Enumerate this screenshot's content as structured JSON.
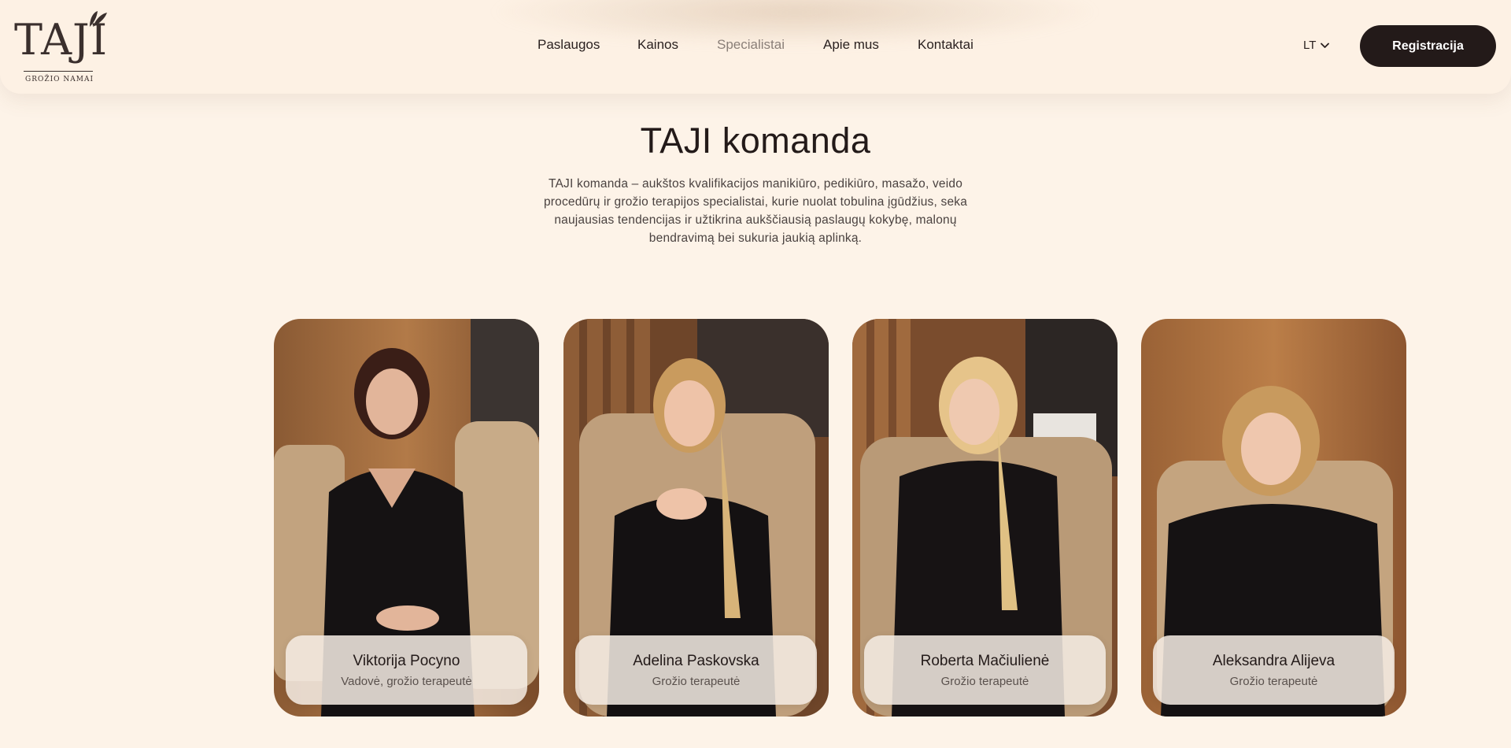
{
  "brand": {
    "name": "TAJI",
    "tagline": "GROŽIO NAMAI"
  },
  "nav": {
    "items": [
      "Paslaugos",
      "Kainos",
      "Specialistai",
      "Apie mus",
      "Kontaktai"
    ],
    "active": "Specialistai"
  },
  "language": {
    "selected": "LT"
  },
  "register_button": "Registracija",
  "hero": {
    "title": "TAJI komanda",
    "description": "TAJI komanda – aukštos kvalifikacijos manikiūro, pedikiūro, masažo, veido procedūrų ir grožio terapijos specialistai, kurie nuolat tobulina įgūdžius, seka naujausias tendencijas ir užtikrina aukščiausią paslaugų kokybę, malonų bendravimą bei sukuria jaukią aplinką."
  },
  "team": [
    {
      "name": "Viktorija Pocyno",
      "role": "Vadovė, grožio terapeutė"
    },
    {
      "name": "Adelina Paskovska",
      "role": "Grožio terapeutė"
    },
    {
      "name": "Roberta Mačiulienė",
      "role": "Grožio terapeutė"
    },
    {
      "name": "Aleksandra Alijeva",
      "role": "Grožio terapeutė"
    }
  ],
  "colors": {
    "background": "#fdf3e8",
    "primary_dark": "#231a19",
    "nav_active": "#8a7f78"
  }
}
